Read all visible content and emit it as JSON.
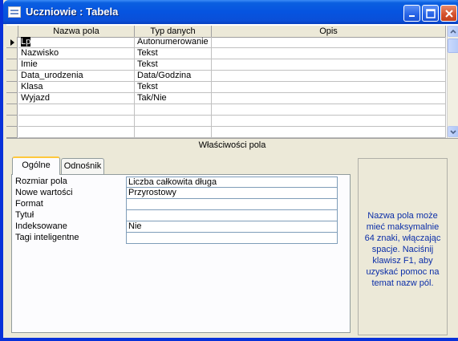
{
  "window": {
    "title": "Uczniowie : Tabela"
  },
  "grid": {
    "columns": [
      "Nazwa pola",
      "Typ danych",
      "Opis"
    ],
    "rows": [
      {
        "name": "Lp",
        "type": "Autonumerowanie",
        "desc": "",
        "current": true
      },
      {
        "name": "Nazwisko",
        "type": "Tekst",
        "desc": ""
      },
      {
        "name": "Imie",
        "type": "Tekst",
        "desc": ""
      },
      {
        "name": "Data_urodzenia",
        "type": "Data/Godzina",
        "desc": ""
      },
      {
        "name": "Klasa",
        "type": "Tekst",
        "desc": ""
      },
      {
        "name": "Wyjazd",
        "type": "Tak/Nie",
        "desc": ""
      },
      {
        "name": "",
        "type": "",
        "desc": ""
      },
      {
        "name": "",
        "type": "",
        "desc": ""
      },
      {
        "name": "",
        "type": "",
        "desc": ""
      }
    ]
  },
  "properties": {
    "section_title": "Właściwości pola",
    "tabs": [
      {
        "label": "Ogólne",
        "active": true
      },
      {
        "label": "Odnośnik",
        "active": false
      }
    ],
    "fields": [
      {
        "label": "Rozmiar pola",
        "value": "Liczba całkowita długa"
      },
      {
        "label": "Nowe wartości",
        "value": "Przyrostowy"
      },
      {
        "label": "Format",
        "value": ""
      },
      {
        "label": "Tytuł",
        "value": ""
      },
      {
        "label": "Indeksowane",
        "value": "Nie"
      },
      {
        "label": "Tagi inteligentne",
        "value": ""
      }
    ],
    "help_text": "Nazwa pola może mieć maksymalnie 64 znaki, włączając spacje. Naciśnij klawisz F1, aby uzyskać pomoc na temat nazw pól."
  },
  "colors": {
    "titlebar": "#0654e0",
    "help_text": "#0b2ea8",
    "active_tab_accent": "#ffc83c"
  }
}
